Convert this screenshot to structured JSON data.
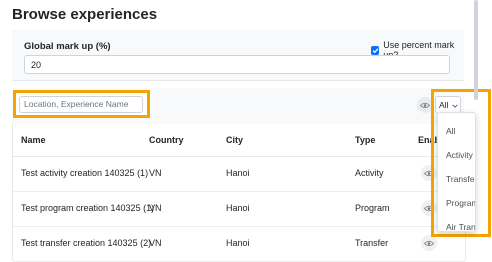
{
  "page": {
    "title": "Browse experiences"
  },
  "markup": {
    "label": "Global mark up (%)",
    "value": "20",
    "use_percent_label": "Use percent mark up?",
    "use_percent_checked": true
  },
  "filters": {
    "search_placeholder": "Location, Experience Name",
    "type_selected": "All"
  },
  "table": {
    "columns": [
      "Name",
      "Country",
      "City",
      "Type",
      "Enab"
    ],
    "rows": [
      {
        "name": "Test activity creation 140325 (1)",
        "country": "VN",
        "city": "Hanoi",
        "type": "Activity"
      },
      {
        "name": "Test program creation 140325 (1)",
        "country": "VN",
        "city": "Hanoi",
        "type": "Program"
      },
      {
        "name": "Test transfer creation 140325 (2)",
        "country": "VN",
        "city": "Hanoi",
        "type": "Transfer"
      }
    ]
  },
  "type_dropdown": {
    "options": [
      "All",
      "Activity",
      "Transfer",
      "Program",
      "Air Tran"
    ]
  },
  "colors": {
    "highlight": "#f5a300",
    "accent": "#0d6efd"
  }
}
